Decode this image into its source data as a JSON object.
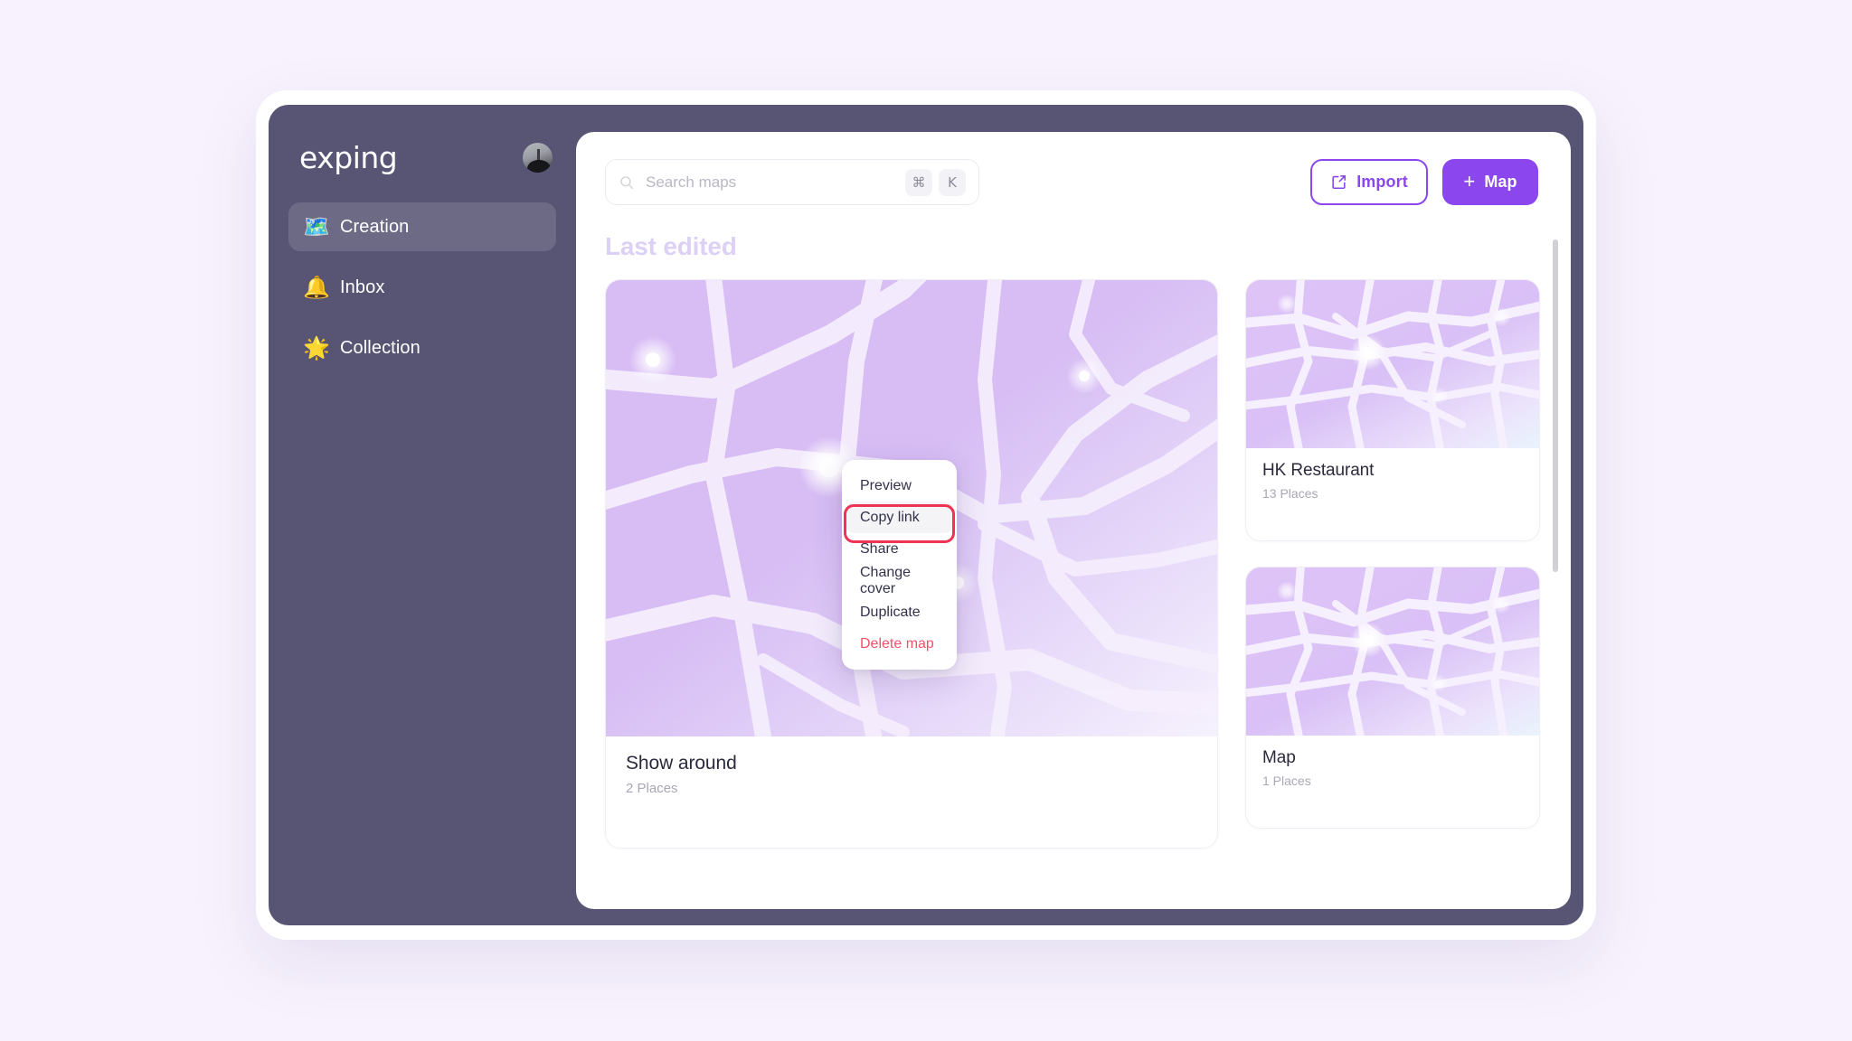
{
  "app": {
    "brand": "exping",
    "avatar_icon": "user-avatar-photo"
  },
  "sidebar": {
    "items": [
      {
        "label": "Creation",
        "emoji": "🗺️",
        "icon": "world-map-icon",
        "active": true
      },
      {
        "label": "Inbox",
        "emoji": "🔔",
        "icon": "bell-icon",
        "active": false
      },
      {
        "label": "Collection",
        "emoji": "🌟",
        "icon": "glowing-star-icon",
        "active": false
      }
    ]
  },
  "search": {
    "placeholder": "Search maps",
    "value": "",
    "icon": "search-icon",
    "shortcut": [
      "⌘",
      "K"
    ]
  },
  "toolbar": {
    "import_label": "Import",
    "import_icon": "import-arrow-icon",
    "map_label": "Map",
    "map_icon": "plus-icon"
  },
  "content": {
    "section_title": "Last edited",
    "cards": [
      {
        "title": "Show around",
        "places": "2 Places"
      },
      {
        "title": "HK Restaurant",
        "places": "13 Places"
      },
      {
        "title": "Map",
        "places": "1 Places"
      }
    ]
  },
  "context_menu": {
    "items": [
      {
        "label": "Preview",
        "danger": false,
        "hovered": false
      },
      {
        "label": "Copy link",
        "danger": false,
        "hovered": true
      },
      {
        "label": "Share",
        "danger": false,
        "hovered": false
      },
      {
        "label": "Change cover",
        "danger": false,
        "hovered": false
      },
      {
        "label": "Duplicate",
        "danger": false,
        "hovered": false
      },
      {
        "label": "Delete map",
        "danger": true,
        "hovered": false
      }
    ]
  },
  "colors": {
    "page_background": "#f7f2fd",
    "app_shell": "#585474",
    "accent_purple": "#8b47ed",
    "section_title": "#ddd0f5",
    "danger_red": "#f2506b",
    "highlight_border": "#ee3355"
  }
}
